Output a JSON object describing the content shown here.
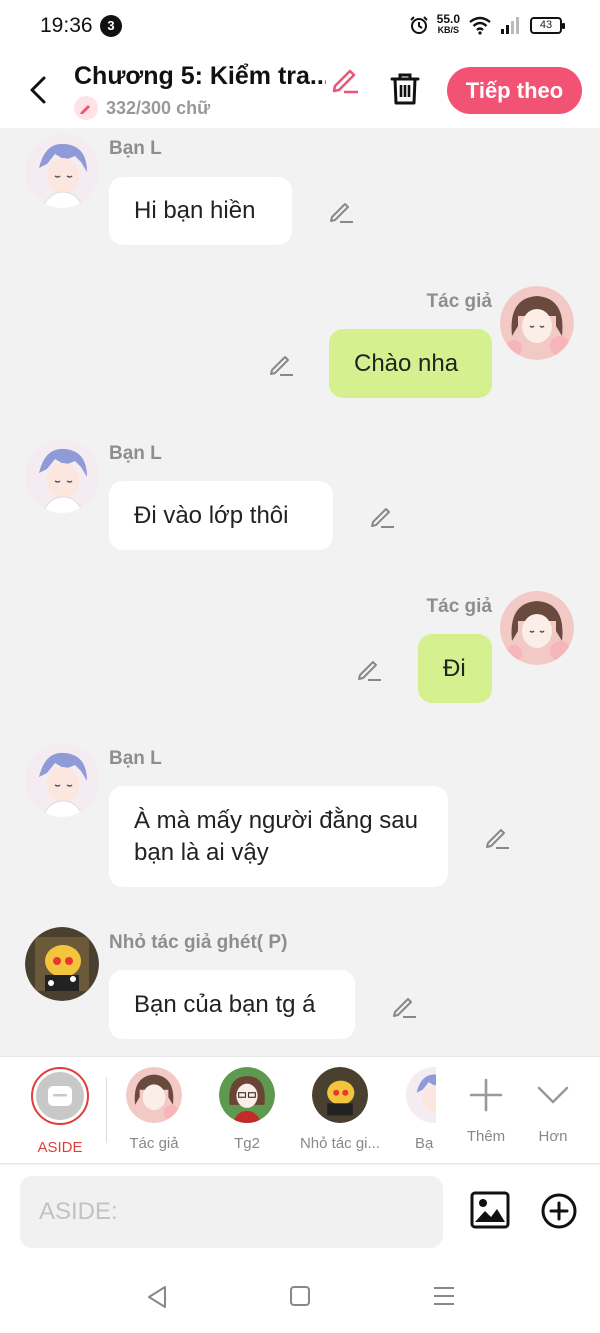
{
  "status_bar": {
    "time": "19:36",
    "notif_count": "3",
    "net_speed": "55.0",
    "net_unit": "KB/S",
    "battery": "43"
  },
  "header": {
    "title": "Chương 5: Kiểm tra...",
    "word_count": "332/300 chữ",
    "next_label": "Tiếp theo"
  },
  "messages": [
    {
      "speaker": "Bạn L",
      "text": "Hi bạn hiền",
      "side": "left"
    },
    {
      "speaker": "Tác giả",
      "text": "Chào nha",
      "side": "right"
    },
    {
      "speaker": "Bạn L",
      "text": "Đi vào lớp thôi",
      "side": "left"
    },
    {
      "speaker": "Tác giả",
      "text": "Đi",
      "side": "right"
    },
    {
      "speaker": "Bạn L",
      "text": "À mà mấy người đằng sau bạn là ai vậy",
      "side": "left"
    },
    {
      "speaker": "Nhỏ tác giả ghét( P)",
      "text": "Bạn của bạn tg á",
      "side": "left"
    }
  ],
  "characters": {
    "aside": "ASIDE",
    "c1": "Tác giả",
    "c2": "Tg2",
    "c3": "Nhỏ tác gi...",
    "c4": "Bạ",
    "more": "Thêm",
    "collapse": "Hơn"
  },
  "composer": {
    "placeholder": "ASIDE:"
  },
  "colors": {
    "accent": "#f25273",
    "bubble_green": "#d4f08f",
    "bubble_white": "#ffffff",
    "aside_ring": "#e23d3d"
  },
  "icons": [
    "back-icon",
    "pencil-icon",
    "trash-icon",
    "image-icon",
    "plus-circle-icon",
    "plus-icon",
    "chevron-down-icon",
    "nav-back-icon",
    "nav-home-icon",
    "nav-menu-icon"
  ]
}
